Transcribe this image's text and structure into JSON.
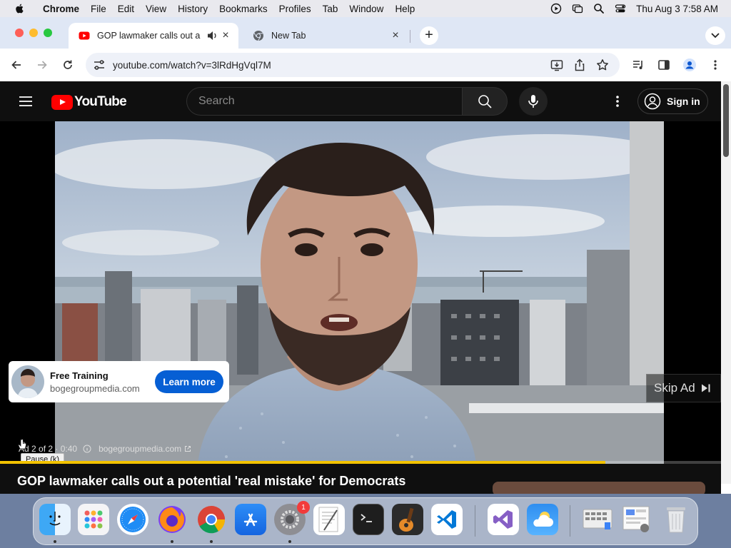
{
  "menubar": {
    "app_name": "Chrome",
    "items": [
      "File",
      "Edit",
      "View",
      "History",
      "Bookmarks",
      "Profiles",
      "Tab",
      "Window",
      "Help"
    ],
    "clock": "Thu Aug 3  7:58 AM"
  },
  "tabs": [
    {
      "title": "GOP lawmaker calls out a",
      "favicon": "youtube-icon",
      "audio": true,
      "active": true
    },
    {
      "title": "New Tab",
      "favicon": "chrome-icon",
      "audio": false,
      "active": false
    }
  ],
  "omnibox": {
    "url": "youtube.com/watch?v=3lRdHgVql7M"
  },
  "youtube": {
    "logo_text": "YouTube",
    "search_placeholder": "Search",
    "sign_in_label": "Sign in"
  },
  "ad": {
    "card_title": "Free Training",
    "card_domain": "bogegroupmedia.com",
    "cta_label": "Learn more",
    "skip_label": "Skip Ad",
    "counter": "Ad 2 of 2 · 0:40",
    "info_icon": "info-icon",
    "advertiser_domain": "bogegroupmedia.com",
    "progress_fraction": 0.84
  },
  "tooltip": "Pause (k)",
  "video_title": "GOP lawmaker calls out a potential 'real mistake' for Democrats",
  "dock": {
    "apps": [
      "finder",
      "launchpad",
      "safari",
      "firefox",
      "chrome",
      "app-store",
      "system-settings",
      "textedit",
      "terminal",
      "garageband",
      "vscode",
      "visual-studio",
      "weather",
      "screen-grid",
      "preview",
      "trash"
    ],
    "settings_badge": "1"
  },
  "colors": {
    "youtube_red": "#ff0000",
    "cta_blue": "#065fd4",
    "ad_progress": "#f2c200"
  }
}
